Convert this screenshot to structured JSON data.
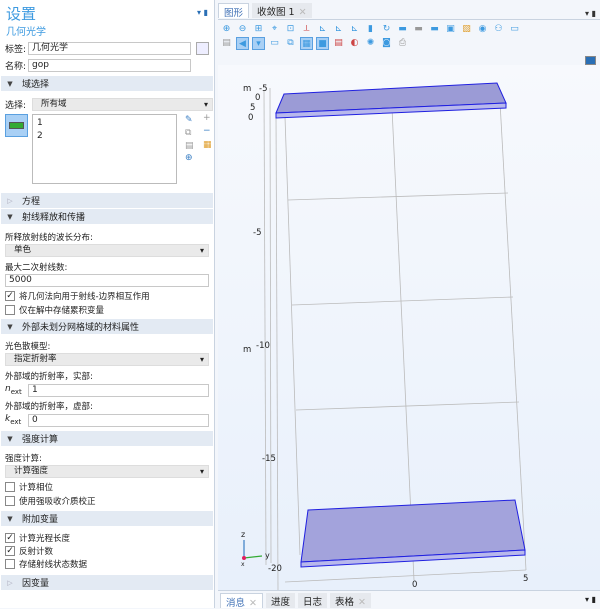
{
  "settings": {
    "title": "设置",
    "subtitle": "几何光学",
    "label_label": "标签:",
    "label_value": "几何光学",
    "name_label": "名称:",
    "name_value": "gop"
  },
  "domain_selection": {
    "header": "域选择",
    "select_label": "选择:",
    "select_value": "所有域",
    "items": [
      "1",
      "2"
    ]
  },
  "equation": {
    "header": "方程"
  },
  "ray_release": {
    "header": "射线释放和传播",
    "wavelength_label": "所释放射线的波长分布:",
    "wavelength_value": "单色",
    "max_rays_label": "最大二次射线数:",
    "max_rays_value": "5000",
    "cb1": "将几何法向用于射线-边界相互作用",
    "cb1_checked": true,
    "cb2": "仅在解中存储累积变量",
    "cb2_checked": false
  },
  "material": {
    "header": "外部未划分网格域的材料属性",
    "dispersion_label": "光色散模型:",
    "dispersion_value": "指定折射率",
    "n_label": "外部域的折射率，实部:",
    "n_sym": "n",
    "n_sub": "ext",
    "n_value": "1",
    "k_label": "外部域的折射率，虚部:",
    "k_sym": "k",
    "k_sub": "ext",
    "k_value": "0"
  },
  "intensity": {
    "header": "强度计算",
    "label": "强度计算:",
    "value": "计算强度",
    "cb1": "计算相位",
    "cb2": "使用强吸收介质校正"
  },
  "additional": {
    "header": "附加变量",
    "cb1": "计算光程长度",
    "cb2": "反射计数",
    "cb3": "存储射线状态数据"
  },
  "dependent": {
    "header": "因变量"
  },
  "graphics": {
    "tabs": [
      {
        "label": "图形"
      },
      {
        "label": "收敛图 1"
      }
    ],
    "axis_labels": {
      "z_ticks": [
        "-5",
        "-10",
        "-15",
        "-20"
      ],
      "unit": "m",
      "top": [
        "-5",
        "0",
        "5",
        "0"
      ],
      "x_ticks": [
        "0",
        "5"
      ]
    },
    "triad": {
      "z": "z",
      "y": "y",
      "x": "x"
    },
    "plate_color": "#9b9bd6",
    "edge_color": "#2020e0"
  },
  "bottom_tabs": [
    "消息",
    "进度",
    "日志",
    "表格"
  ]
}
